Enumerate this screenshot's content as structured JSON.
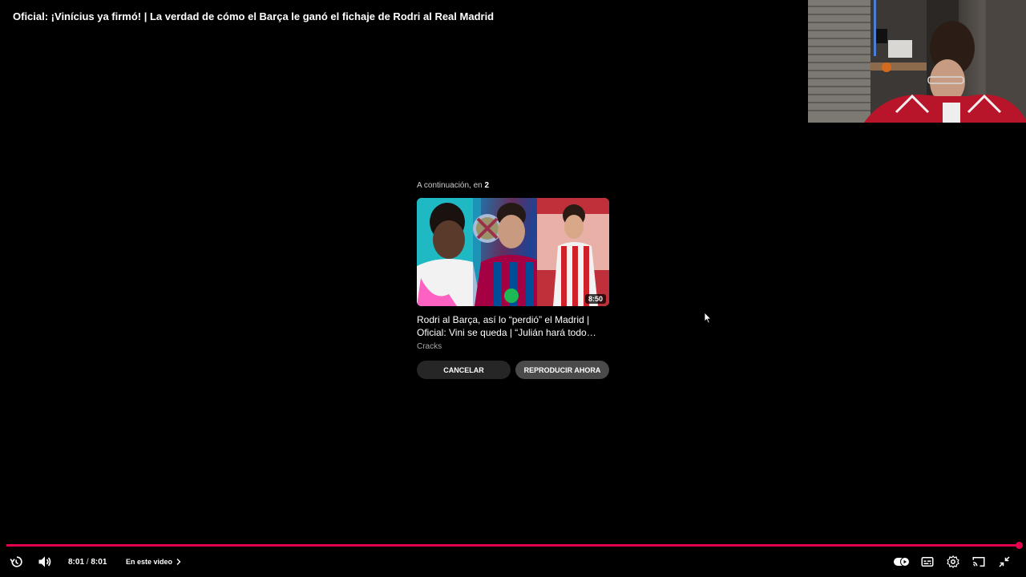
{
  "video": {
    "title": "Oficial: ¡Vinícius ya firmó! | La verdad de cómo el Barça le ganó el fichaje de Rodri al Real Madrid"
  },
  "up_next": {
    "header_label": "A continuación, en",
    "countdown": "2",
    "duration": "8:50",
    "title": "Rodri al Barça, así lo “perdió” el Madrid | Oficial: Vini se queda | “Julián hará todo par…",
    "channel": "Cracks",
    "cancel_label": "CANCELAR",
    "play_now_label": "REPRODUCIR AHORA"
  },
  "controls": {
    "current_time": "8:01",
    "separator": "/",
    "total_time": "8:01",
    "chapter_label": "En este video",
    "progress_fraction": 1.0,
    "icons": {
      "replay": "replay-icon",
      "volume": "volume-icon",
      "chevron": "chevron-right-icon",
      "autoplay": "autoplay-toggle-icon",
      "subtitles": "subtitles-icon",
      "settings": "gear-icon",
      "cast": "cast-icon",
      "exit_fullscreen": "exit-fullscreen-icon"
    }
  },
  "colors": {
    "progress": "#e3004f",
    "background": "#000000"
  }
}
